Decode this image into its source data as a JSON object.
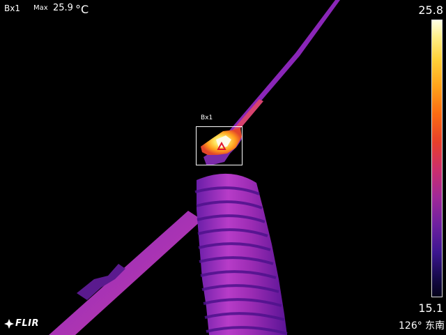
{
  "hud": {
    "box_id": "Bx1",
    "max_label": "Max",
    "max_value": "25.9",
    "unit": "°C"
  },
  "scale": {
    "max": "25.8",
    "min": "15.1",
    "palette": [
      "#ffffe6",
      "#fff08a",
      "#ffd23a",
      "#ffa21a",
      "#fb6b12",
      "#e8402a",
      "#cc2e6c",
      "#a02898",
      "#6e20a0",
      "#3c1690",
      "#160a4a",
      "#04021a"
    ]
  },
  "measurement_box": {
    "label": "Bx1",
    "marker_icon": "hotspot-triangle-icon"
  },
  "brand": {
    "logo_text": "FLIR",
    "logo_icon": "flir-logo-icon"
  },
  "compass": {
    "text": "126° 东南"
  }
}
